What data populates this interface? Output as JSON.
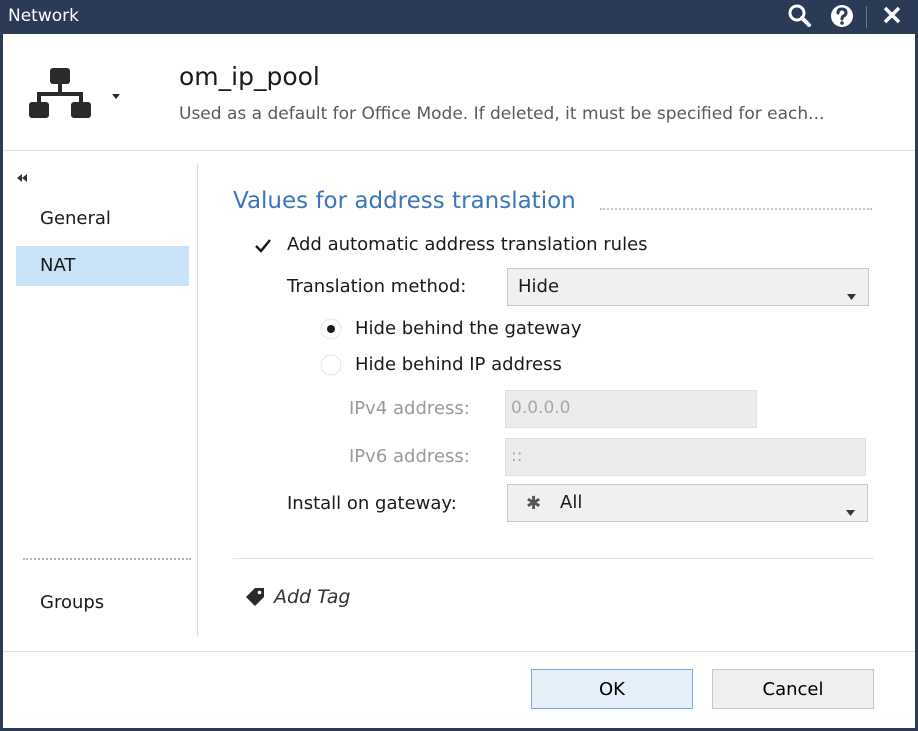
{
  "window": {
    "title": "Network"
  },
  "header": {
    "object_name": "om_ip_pool",
    "description": "Used as a default for Office Mode. If deleted, it must be specified for each..."
  },
  "sidebar": {
    "items": [
      {
        "label": "General",
        "selected": false
      },
      {
        "label": "NAT",
        "selected": true
      },
      {
        "label": "Groups",
        "selected": false
      }
    ]
  },
  "nat": {
    "section_title": "Values for address translation",
    "auto_rules_label": "Add automatic address translation rules",
    "auto_rules_checked": true,
    "method_label": "Translation method:",
    "method_value": "Hide",
    "hide_gateway_label": "Hide behind the gateway",
    "hide_ip_label": "Hide behind IP address",
    "selected_option": "Hide behind the gateway",
    "ipv4_label": "IPv4 address:",
    "ipv4_value": "0.0.0.0",
    "ipv6_label": "IPv6 address:",
    "ipv6_value": "::",
    "install_label": "Install on gateway:",
    "install_value": "All"
  },
  "tags": {
    "add_label": "Add Tag"
  },
  "buttons": {
    "ok": "OK",
    "cancel": "Cancel"
  },
  "colors": {
    "titlebar": "#2b3a55",
    "accent_title": "#3a76b8",
    "nav_selected": "#c9e2f7",
    "ok_button": "#e6f0fa"
  },
  "icons": {
    "search": "search-icon",
    "help": "help-icon",
    "close": "close-icon",
    "object": "network-icon",
    "collapse": "collapse-icon",
    "tag": "tag-icon"
  }
}
